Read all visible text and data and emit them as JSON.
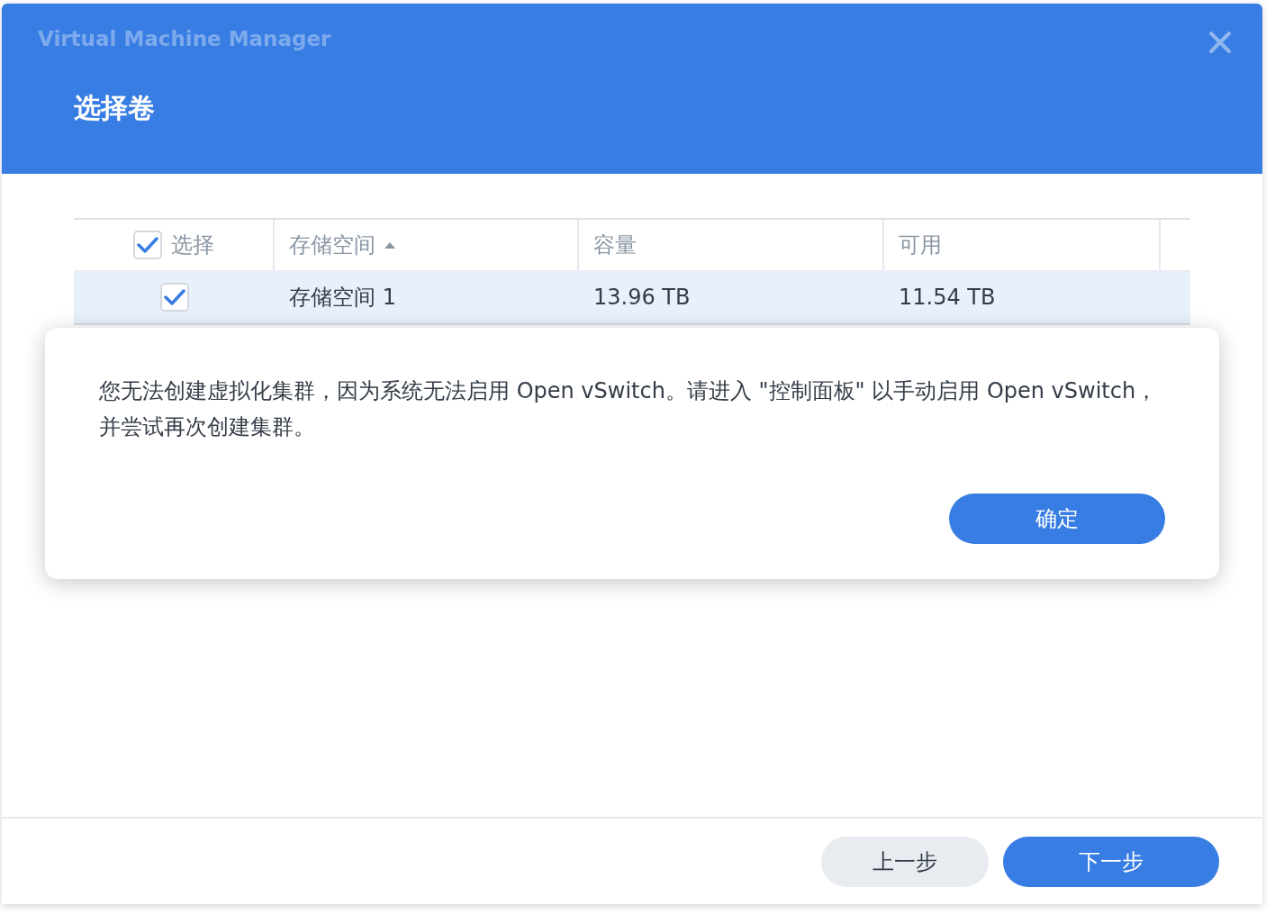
{
  "window": {
    "title": "Virtual Machine Manager",
    "step_title": "选择卷"
  },
  "table": {
    "select_all": {
      "label": "选择",
      "checked": true
    },
    "columns": [
      {
        "label": "存储空间",
        "sorted": true
      },
      {
        "label": "容量",
        "sorted": false
      },
      {
        "label": "可用",
        "sorted": false
      }
    ],
    "rows": [
      {
        "selected": true,
        "checked": true,
        "cells": [
          "存储空间 1",
          "13.96 TB",
          "11.54 TB"
        ]
      }
    ]
  },
  "alert": {
    "message": "您无法创建虚拟化集群，因为系统无法启用 Open vSwitch。请进入 \"控制面板\" 以手动启用 Open vSwitch，并尝试再次创建集群。",
    "button": "确定"
  },
  "footer": {
    "buttons": [
      {
        "label": "上一步",
        "kind": "secondary"
      },
      {
        "label": "下一步",
        "kind": "primary"
      }
    ]
  }
}
